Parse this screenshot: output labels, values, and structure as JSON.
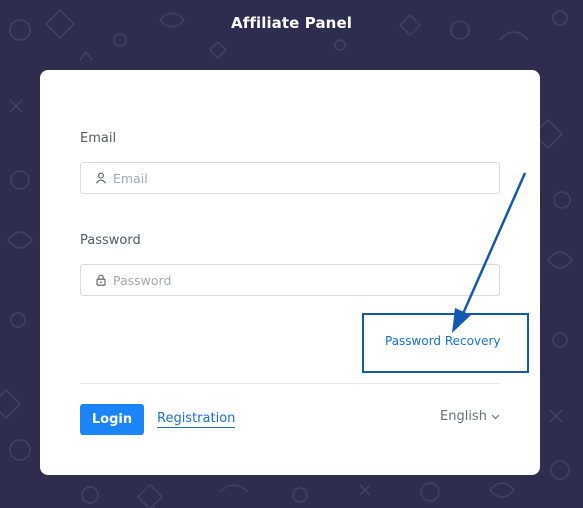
{
  "header": {
    "title": "Affiliate Panel"
  },
  "form": {
    "email": {
      "label": "Email",
      "placeholder": "Email",
      "value": ""
    },
    "password": {
      "label": "Password",
      "placeholder": "Password",
      "value": ""
    },
    "recovery_link": "Password Recovery",
    "login_label": "Login",
    "registration_label": "Registration",
    "language": "English"
  },
  "icons": {
    "email_icon": "user-icon",
    "password_icon": "lock-icon",
    "language_icon": "chevron-down-icon"
  },
  "colors": {
    "background": "#2e2c4f",
    "card": "#ffffff",
    "primary": "#1b84f7",
    "link": "#1a6fd1",
    "annotation": "#1459b0"
  }
}
